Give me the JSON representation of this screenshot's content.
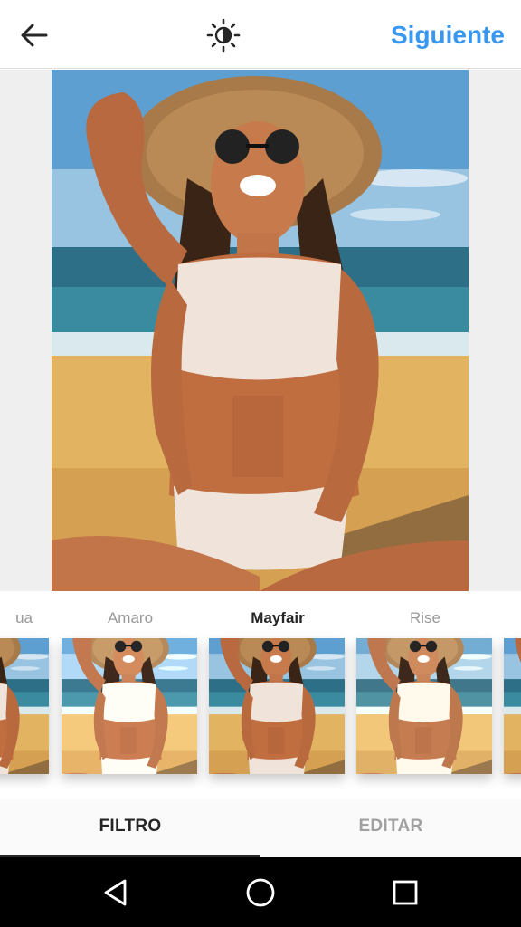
{
  "topbar": {
    "back_icon": "arrow-left-icon",
    "lux_icon": "sun-contrast-icon",
    "next_label": "Siguiente",
    "accent": "#3897f0"
  },
  "filters": {
    "items": [
      {
        "label": "ua",
        "selected": false
      },
      {
        "label": "Amaro",
        "selected": false
      },
      {
        "label": "Mayfair",
        "selected": true
      },
      {
        "label": "Rise",
        "selected": false
      },
      {
        "label": "",
        "selected": false
      }
    ]
  },
  "tabs": {
    "filter_label": "FILTRO",
    "edit_label": "EDITAR",
    "active": "FILTRO"
  },
  "navbar": {
    "back_icon": "nav-back-triangle-icon",
    "home_icon": "nav-home-circle-icon",
    "recents_icon": "nav-recents-square-icon"
  }
}
